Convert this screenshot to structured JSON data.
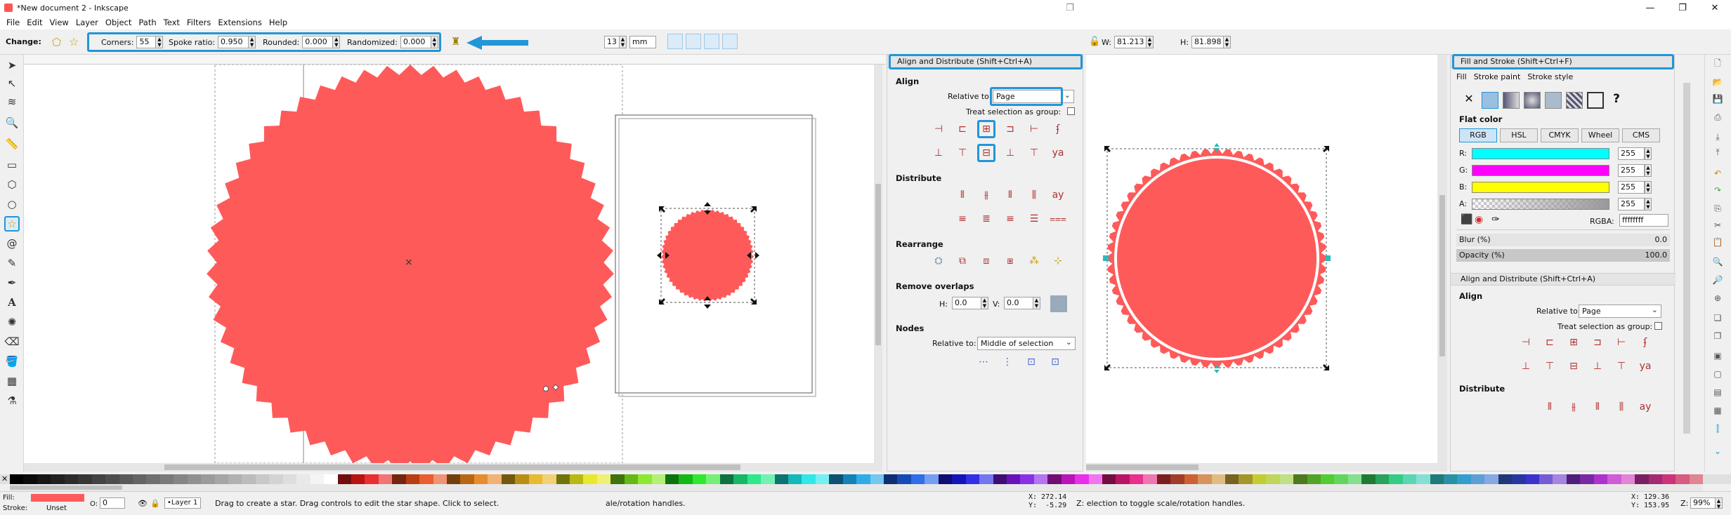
{
  "window": {
    "title": "*New document 2 - Inkscape",
    "minimize": "—",
    "restore": "❐",
    "close": "✕"
  },
  "menu": [
    "File",
    "Edit",
    "View",
    "Layer",
    "Object",
    "Path",
    "Text",
    "Filters",
    "Extensions",
    "Help"
  ],
  "toolbar": {
    "change_label": "Change:",
    "corners_label": "Corners:",
    "corners_value": "55",
    "spoke_label": "Spoke ratio:",
    "spoke_value": "0.950",
    "rounded_label": "Rounded:",
    "rounded_value": "0.000",
    "randomized_label": "Randomized:",
    "randomized_value": "0.000",
    "x_value": "13",
    "unit": "mm",
    "w_label": "W:",
    "w_value": "81.213",
    "h_label": "H:",
    "h_value": "81.898"
  },
  "align_panel": {
    "title": "Align and Distribute (Shift+Ctrl+A)",
    "align_section": "Align",
    "relative_to_label": "Relative to:",
    "relative_to_value": "Page",
    "treat_selection_label": "Treat selection as group:",
    "distribute_section": "Distribute",
    "rearrange_section": "Rearrange",
    "remove_overlaps_section": "Remove overlaps",
    "h_label": "H:",
    "h_value": "0.0",
    "v_label": "V:",
    "v_value": "0.0",
    "nodes_section": "Nodes",
    "nodes_relative_label": "Relative to:",
    "nodes_relative_value": "Middle of selection"
  },
  "fill_panel": {
    "title": "Fill and Stroke (Shift+Ctrl+F)",
    "tab_fill": "Fill",
    "tab_stroke_paint": "Stroke paint",
    "tab_stroke_style": "Stroke style",
    "flat_color": "Flat color",
    "modes": [
      "RGB",
      "HSL",
      "CMYK",
      "Wheel",
      "CMS"
    ],
    "channels": [
      {
        "label": "R:",
        "value": "255",
        "color": "#00ffff"
      },
      {
        "label": "G:",
        "value": "255",
        "color": "#ff00ff"
      },
      {
        "label": "B:",
        "value": "255",
        "color": "#ffff00"
      },
      {
        "label": "A:",
        "value": "255",
        "color": "#999999"
      }
    ],
    "rgba_label": "RGBA:",
    "rgba_value": "ffffffff",
    "blur_label": "Blur (%)",
    "blur_value": "0.0",
    "opacity_label": "Opacity (%)",
    "opacity_value": "100.0",
    "second_title": "Align and Distribute (Shift+Ctrl+A)",
    "second_align": "Align",
    "second_relative_label": "Relative to:",
    "second_relative_value": "Page",
    "second_treat": "Treat selection as group:",
    "second_distribute": "Distribute"
  },
  "status": {
    "fill_label": "Fill:",
    "stroke_label": "Stroke:",
    "stroke_value": "Unset",
    "opacity_label": "O:",
    "opacity_value": "0",
    "layer": "•Layer 1",
    "message": "Drag to create a star. Drag controls to edit the star shape. Click to select.",
    "message2": "ale/rotation handles.",
    "xy1": "X: 272.14\nY:  -5.29",
    "message3": "Z: election to toggle scale/rotation handles.",
    "xy2": "X: 129.36\nY: 153.95",
    "zoom_label": "Z:",
    "zoom_value": "99%"
  },
  "colors": {
    "star": "#ff5a5a",
    "accent": "#2196d8"
  }
}
